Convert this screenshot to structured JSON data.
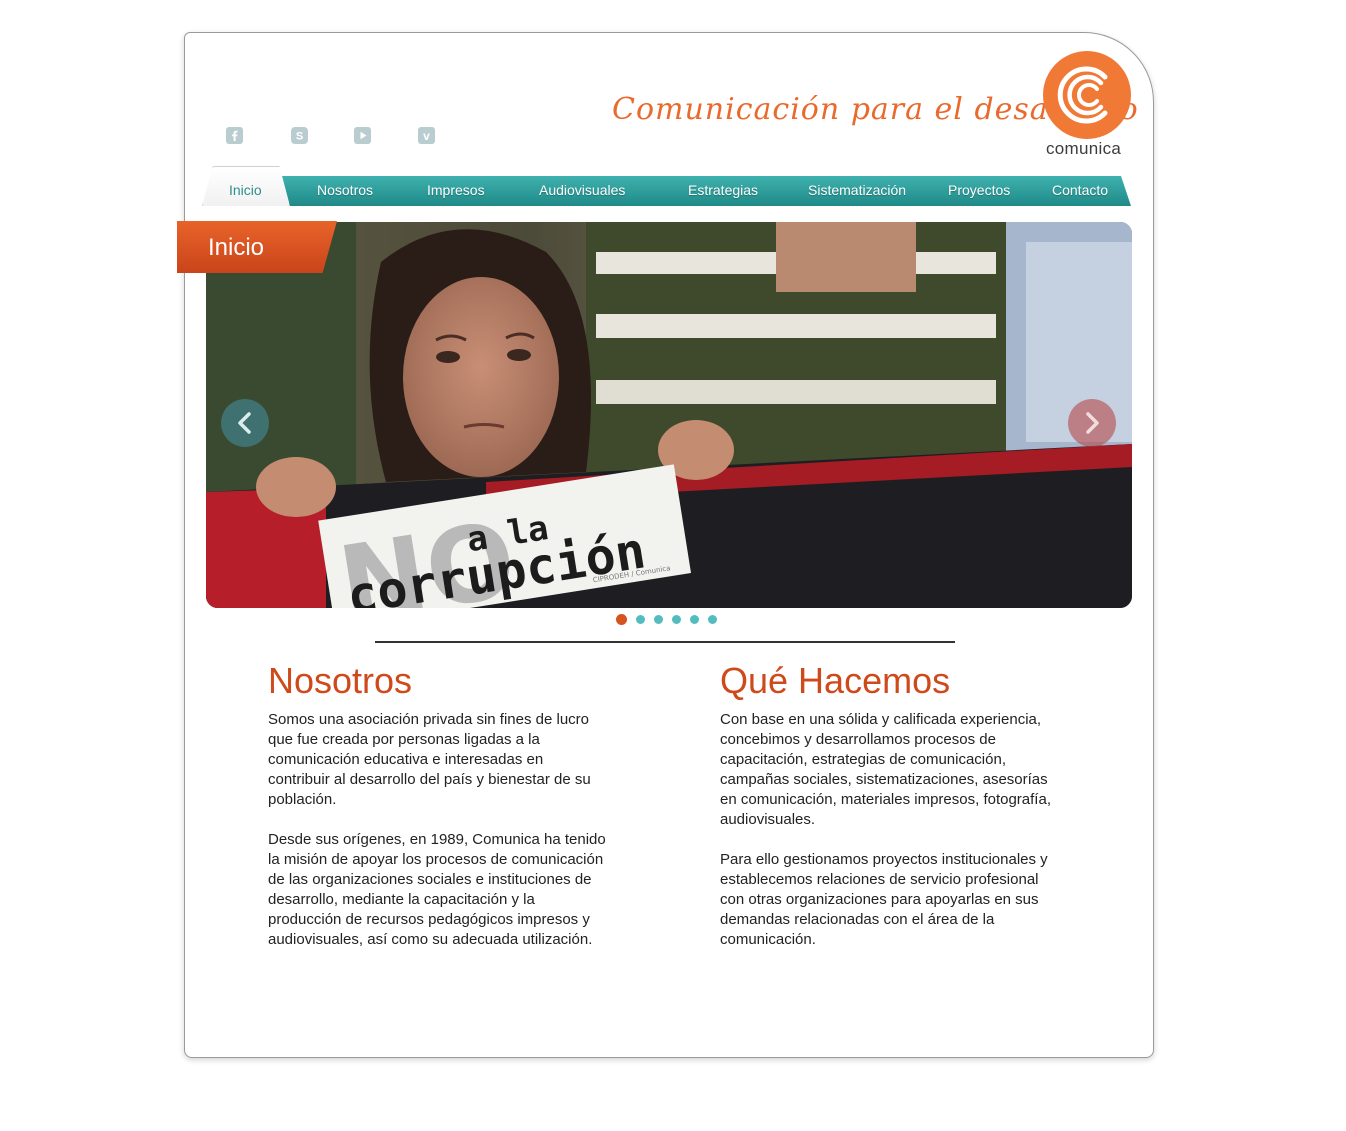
{
  "social": {
    "icons": [
      "facebook-icon",
      "skype-icon",
      "youtube-icon",
      "vimeo-icon"
    ],
    "color": "#b9cdd0"
  },
  "header": {
    "tagline": "Comunicación para el desarrollo",
    "logo_text": "comunica",
    "brand_orange": "#e96a2c"
  },
  "nav": {
    "items": [
      {
        "label": "Inicio",
        "active": true
      },
      {
        "label": "Nosotros"
      },
      {
        "label": "Impresos"
      },
      {
        "label": "Audiovisuales"
      },
      {
        "label": "Estrategias"
      },
      {
        "label": "Sistematización"
      },
      {
        "label": "Proyectos"
      },
      {
        "label": "Contacto"
      }
    ],
    "bar_color": "#2a9a98"
  },
  "slider": {
    "badge": "Inicio",
    "sign_line1": "NO",
    "sign_line2": "a la",
    "sign_line3": "corrupción",
    "sign_credit": "CIPRODEH / Comunica",
    "slide_count": 6,
    "active_slide": 1
  },
  "about": {
    "title": "Nosotros",
    "p1": "Somos una asociación privada sin fines de lucro que fue creada por personas ligadas a la comunicación educativa e interesadas en contribuir al desarrollo del país y bienestar de su población.",
    "p2": "Desde sus orígenes, en 1989, Comunica ha tenido la misión de apoyar los procesos de comunicación de las organizaciones sociales e instituciones de desarrollo, mediante la capacitación y la producción de recursos pedagógicos impresos y audiovisuales, así como su adecuada utilización."
  },
  "services": {
    "title": "Qué Hacemos",
    "p1": "Con base en una sólida y calificada experiencia, concebimos y desarrollamos procesos de capacitación, estrategias de comunicación, campañas sociales, sistematizaciones, asesorías en comunicación, materiales impresos, fotografía, audiovisuales.",
    "p2": "Para ello gestionamos proyectos institucionales y establecemos relaciones de servicio profesional con otras organizaciones para apoyarlas en sus demandas relacionadas con el área de la comunicación."
  }
}
